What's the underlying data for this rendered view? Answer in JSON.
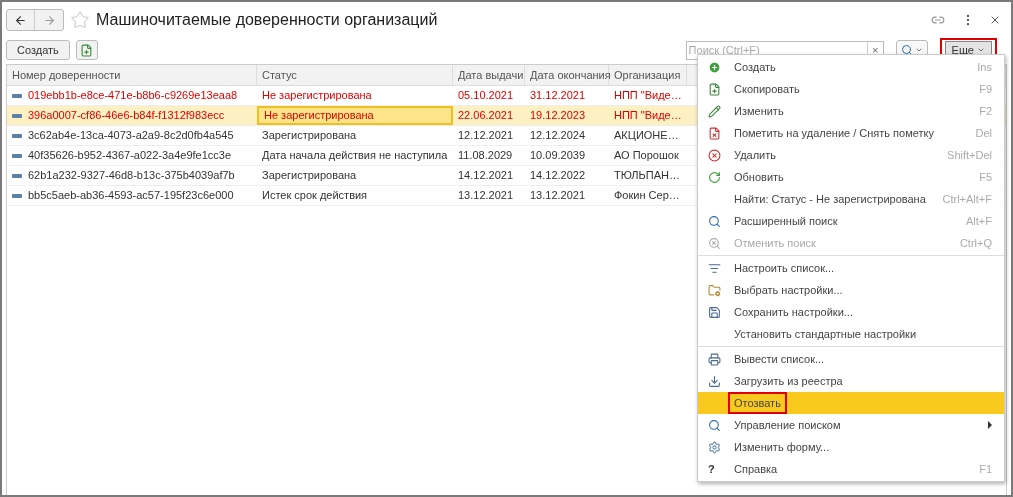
{
  "window": {
    "title": "Машиночитаемые доверенности организаций",
    "favorite": false
  },
  "toolbar": {
    "create": "Создать",
    "search": {
      "placeholder": "Поиск (Ctrl+F)",
      "clear": "×"
    },
    "more": {
      "label": "Еще",
      "highlighted": true
    }
  },
  "table": {
    "columns": [
      "Номер доверенности",
      "Статус",
      "Дата выдачи",
      "Дата окончания",
      "Организация"
    ],
    "rows": [
      {
        "selected": false,
        "alert": true,
        "cells": [
          {
            "text": "019ebb1b-e8ce-471e-b8b6-c9269e13eaa8",
            "focused": false
          },
          {
            "text": "Не зарегистрирована",
            "focused": false
          },
          {
            "text": "05.10.2021",
            "focused": false
          },
          {
            "text": "31.12.2021",
            "focused": false
          },
          {
            "text": "НПП \"Виде…",
            "focused": false
          }
        ]
      },
      {
        "selected": true,
        "alert": true,
        "cells": [
          {
            "text": "396a0007-cf86-46e6-b84f-f1312f983ecc",
            "focused": false
          },
          {
            "text": "Не зарегистрирована",
            "focused": true
          },
          {
            "text": "22.06.2021",
            "focused": false
          },
          {
            "text": "19.12.2023",
            "focused": false
          },
          {
            "text": "НПП \"Виде…",
            "focused": false
          }
        ]
      },
      {
        "selected": false,
        "alert": false,
        "cells": [
          {
            "text": "3c62ab4e-13ca-4073-a2a9-8c2d0fb4a545",
            "focused": false
          },
          {
            "text": "Зарегистрирована",
            "focused": false
          },
          {
            "text": "12.12.2021",
            "focused": false
          },
          {
            "text": "12.12.2024",
            "focused": false
          },
          {
            "text": "АКЦИОНЕ…",
            "focused": false
          }
        ]
      },
      {
        "selected": false,
        "alert": false,
        "cells": [
          {
            "text": "40f35626-b952-4367-a022-3a4e9fe1cc3e",
            "focused": false
          },
          {
            "text": "Дата начала действия не наступила",
            "focused": false
          },
          {
            "text": "11.08.2029",
            "focused": false
          },
          {
            "text": "10.09.2039",
            "focused": false
          },
          {
            "text": "АО Порошок",
            "focused": false
          }
        ]
      },
      {
        "selected": false,
        "alert": false,
        "cells": [
          {
            "text": "62b1a232-9327-46d8-b13c-375b4039af7b",
            "focused": false
          },
          {
            "text": "Зарегистрирована",
            "focused": false
          },
          {
            "text": "14.12.2021",
            "focused": false
          },
          {
            "text": "14.12.2022",
            "focused": false
          },
          {
            "text": "ТЮЛЬПАН…",
            "focused": false
          }
        ]
      },
      {
        "selected": false,
        "alert": false,
        "cells": [
          {
            "text": "bb5c5aeb-ab36-4593-ac57-195f23c6e000",
            "focused": false
          },
          {
            "text": "Истек срок действия",
            "focused": false
          },
          {
            "text": "13.12.2021",
            "focused": false
          },
          {
            "text": "13.12.2021",
            "focused": false
          },
          {
            "text": "Фокин Сер…",
            "focused": false
          }
        ]
      }
    ]
  },
  "menu": {
    "items": [
      {
        "kind": "item",
        "label": "Создать",
        "shortcut": "Ins",
        "disabled": false,
        "selected": false,
        "highlighted": false
      },
      {
        "kind": "item",
        "label": "Скопировать",
        "shortcut": "F9",
        "disabled": false,
        "selected": false,
        "highlighted": false
      },
      {
        "kind": "item",
        "label": "Изменить",
        "shortcut": "F2",
        "disabled": false,
        "selected": false,
        "highlighted": false
      },
      {
        "kind": "item",
        "label": "Пометить на удаление / Снять пометку",
        "shortcut": "Del",
        "disabled": false,
        "selected": false,
        "highlighted": false
      },
      {
        "kind": "item",
        "label": "Удалить",
        "shortcut": "Shift+Del",
        "disabled": false,
        "selected": false,
        "highlighted": false
      },
      {
        "kind": "item",
        "label": "Обновить",
        "shortcut": "F5",
        "disabled": false,
        "selected": false,
        "highlighted": false
      },
      {
        "kind": "item",
        "label": "Найти: Статус - Не зарегистрирована",
        "shortcut": "Ctrl+Alt+F",
        "disabled": false,
        "selected": false,
        "highlighted": false
      },
      {
        "kind": "item",
        "label": "Расширенный поиск",
        "shortcut": "Alt+F",
        "disabled": false,
        "selected": false,
        "highlighted": false
      },
      {
        "kind": "item",
        "label": "Отменить поиск",
        "shortcut": "Ctrl+Q",
        "disabled": true,
        "selected": false,
        "highlighted": false
      },
      {
        "kind": "separator"
      },
      {
        "kind": "item",
        "label": "Настроить список...",
        "disabled": false,
        "selected": false,
        "highlighted": false
      },
      {
        "kind": "item",
        "label": "Выбрать настройки...",
        "disabled": false,
        "selected": false,
        "highlighted": false
      },
      {
        "kind": "item",
        "label": "Сохранить настройки...",
        "disabled": false,
        "selected": false,
        "highlighted": false
      },
      {
        "kind": "item",
        "label": "Установить стандартные настройки",
        "disabled": false,
        "selected": false,
        "highlighted": false
      },
      {
        "kind": "separator"
      },
      {
        "kind": "item",
        "label": "Вывести список...",
        "disabled": false,
        "selected": false,
        "highlighted": false
      },
      {
        "kind": "item",
        "label": "Загрузить из реестра",
        "disabled": false,
        "selected": false,
        "highlighted": false
      },
      {
        "kind": "item",
        "label": "Отозвать",
        "disabled": false,
        "selected": true,
        "highlighted": true
      },
      {
        "kind": "submenu",
        "label": "Управление поиском",
        "disabled": false,
        "selected": false,
        "highlighted": false
      },
      {
        "kind": "item",
        "label": "Изменить форму...",
        "disabled": false,
        "selected": false,
        "highlighted": false
      },
      {
        "kind": "item",
        "label": "Справка",
        "glyph": "?",
        "shortcut": "F1",
        "disabled": false,
        "selected": false,
        "highlighted": false
      }
    ]
  }
}
